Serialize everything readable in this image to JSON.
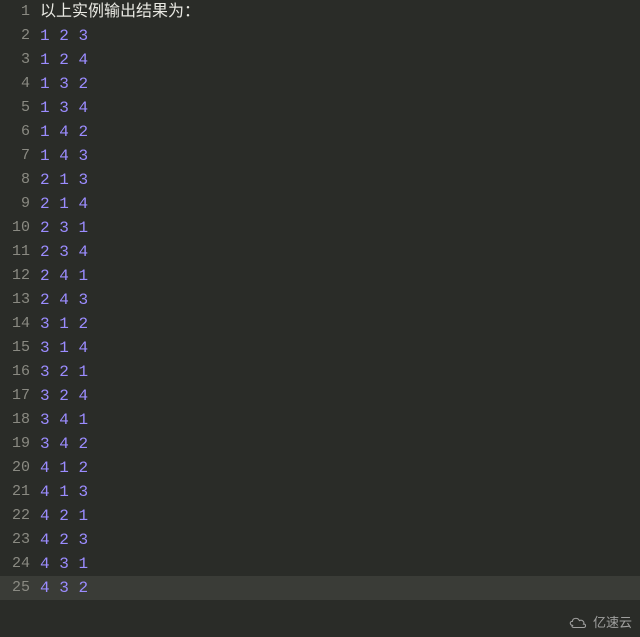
{
  "lines": [
    {
      "n": 1,
      "type": "text",
      "text": "以上实例输出结果为：",
      "hl": false
    },
    {
      "n": 2,
      "type": "nums",
      "vals": [
        "1",
        "2",
        "3"
      ],
      "hl": false
    },
    {
      "n": 3,
      "type": "nums",
      "vals": [
        "1",
        "2",
        "4"
      ],
      "hl": false
    },
    {
      "n": 4,
      "type": "nums",
      "vals": [
        "1",
        "3",
        "2"
      ],
      "hl": false
    },
    {
      "n": 5,
      "type": "nums",
      "vals": [
        "1",
        "3",
        "4"
      ],
      "hl": false
    },
    {
      "n": 6,
      "type": "nums",
      "vals": [
        "1",
        "4",
        "2"
      ],
      "hl": false
    },
    {
      "n": 7,
      "type": "nums",
      "vals": [
        "1",
        "4",
        "3"
      ],
      "hl": false
    },
    {
      "n": 8,
      "type": "nums",
      "vals": [
        "2",
        "1",
        "3"
      ],
      "hl": false
    },
    {
      "n": 9,
      "type": "nums",
      "vals": [
        "2",
        "1",
        "4"
      ],
      "hl": false
    },
    {
      "n": 10,
      "type": "nums",
      "vals": [
        "2",
        "3",
        "1"
      ],
      "hl": false
    },
    {
      "n": 11,
      "type": "nums",
      "vals": [
        "2",
        "3",
        "4"
      ],
      "hl": false
    },
    {
      "n": 12,
      "type": "nums",
      "vals": [
        "2",
        "4",
        "1"
      ],
      "hl": false
    },
    {
      "n": 13,
      "type": "nums",
      "vals": [
        "2",
        "4",
        "3"
      ],
      "hl": false
    },
    {
      "n": 14,
      "type": "nums",
      "vals": [
        "3",
        "1",
        "2"
      ],
      "hl": false
    },
    {
      "n": 15,
      "type": "nums",
      "vals": [
        "3",
        "1",
        "4"
      ],
      "hl": false
    },
    {
      "n": 16,
      "type": "nums",
      "vals": [
        "3",
        "2",
        "1"
      ],
      "hl": false
    },
    {
      "n": 17,
      "type": "nums",
      "vals": [
        "3",
        "2",
        "4"
      ],
      "hl": false
    },
    {
      "n": 18,
      "type": "nums",
      "vals": [
        "3",
        "4",
        "1"
      ],
      "hl": false
    },
    {
      "n": 19,
      "type": "nums",
      "vals": [
        "3",
        "4",
        "2"
      ],
      "hl": false
    },
    {
      "n": 20,
      "type": "nums",
      "vals": [
        "4",
        "1",
        "2"
      ],
      "hl": false
    },
    {
      "n": 21,
      "type": "nums",
      "vals": [
        "4",
        "1",
        "3"
      ],
      "hl": false
    },
    {
      "n": 22,
      "type": "nums",
      "vals": [
        "4",
        "2",
        "1"
      ],
      "hl": false
    },
    {
      "n": 23,
      "type": "nums",
      "vals": [
        "4",
        "2",
        "3"
      ],
      "hl": false
    },
    {
      "n": 24,
      "type": "nums",
      "vals": [
        "4",
        "3",
        "1"
      ],
      "hl": false
    },
    {
      "n": 25,
      "type": "nums",
      "vals": [
        "4",
        "3",
        "2"
      ],
      "hl": true
    }
  ],
  "watermark": "亿速云"
}
